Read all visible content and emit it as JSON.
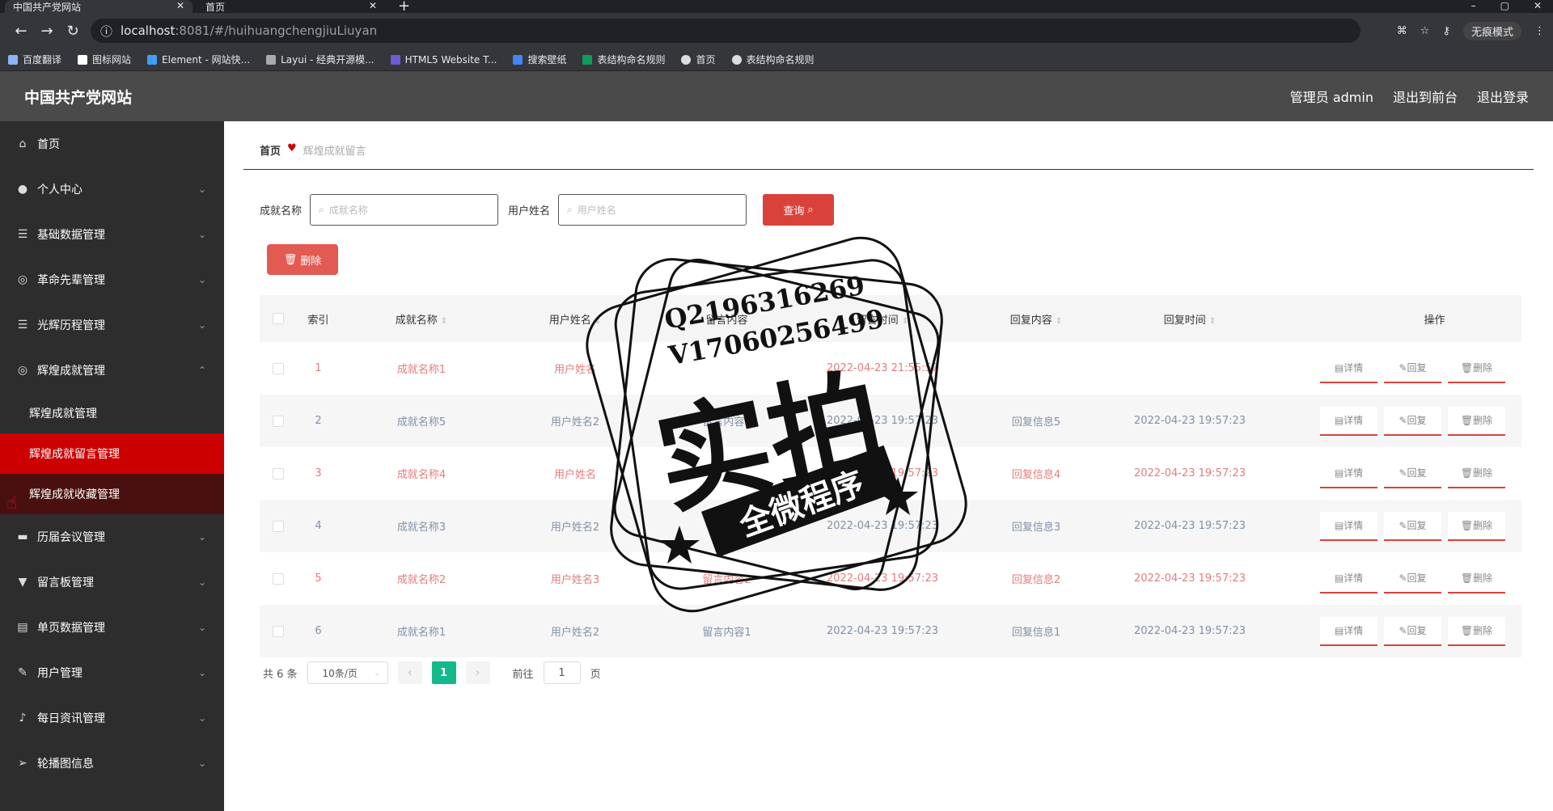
{
  "browser": {
    "tabs": [
      {
        "label": "中国共产党网站",
        "active": true
      },
      {
        "label": "首页",
        "active": false
      }
    ],
    "url_host": "localhost",
    "url_path": ":8081/#/huihuangchengjiuLiuyan",
    "incognito_label": "无痕模式",
    "bookmarks": [
      "百度翻译",
      "图标网站",
      "Element - 网站快...",
      "Layui - 经典开源模...",
      "HTML5 Website T...",
      "搜索壁纸",
      "表结构命名规则",
      "首页",
      "表结构命名规则"
    ]
  },
  "header": {
    "title": "中国共产党网站",
    "admin": "管理员 admin",
    "to_front": "退出到前台",
    "logout": "退出登录"
  },
  "sidebar": {
    "items": [
      {
        "label": "首页",
        "icon": "home-icon"
      },
      {
        "label": "个人中心",
        "icon": "user-icon"
      },
      {
        "label": "基础数据管理",
        "icon": "list-icon"
      },
      {
        "label": "革命先辈管理",
        "icon": "compass-icon"
      },
      {
        "label": "光辉历程管理",
        "icon": "list-icon"
      },
      {
        "label": "辉煌成就管理",
        "icon": "compass-icon"
      }
    ],
    "sub_items": [
      "辉煌成就管理",
      "辉煌成就留言管理",
      "辉煌成就收藏管理"
    ],
    "items_after": [
      {
        "label": "历届会议管理",
        "icon": "briefcase-icon"
      },
      {
        "label": "留言板管理",
        "icon": "board-icon"
      },
      {
        "label": "单页数据管理",
        "icon": "doc-icon"
      },
      {
        "label": "用户管理",
        "icon": "pen-icon"
      },
      {
        "label": "每日资讯管理",
        "icon": "mic-icon"
      },
      {
        "label": "轮播图信息",
        "icon": "send-icon"
      }
    ]
  },
  "breadcrumb": {
    "home": "首页",
    "current": "辉煌成就留言"
  },
  "search": {
    "name_label": "成就名称",
    "name_placeholder": "成就名称",
    "user_label": "用户姓名",
    "user_placeholder": "用户姓名",
    "query_label": "查询",
    "delete_label": "删除"
  },
  "table": {
    "headers": {
      "idx": "索引",
      "name": "成就名称",
      "user": "用户姓名",
      "msg": "留言内容",
      "time": "留言时间",
      "reply": "回复内容",
      "rtime": "回复时间",
      "op": "操作"
    },
    "rows": [
      {
        "idx": "1",
        "name": "成就名称1",
        "user": "用户姓名",
        "msg": "",
        "time": "2022-04-23 21:55:57",
        "reply": "",
        "rtime": "",
        "style": "pink"
      },
      {
        "idx": "2",
        "name": "成就名称5",
        "user": "用户姓名2",
        "msg": "留言内容5",
        "time": "2022-04-23 19:57:23",
        "reply": "回复信息5",
        "rtime": "2022-04-23 19:57:23",
        "style": "blue"
      },
      {
        "idx": "3",
        "name": "成就名称4",
        "user": "用户姓名",
        "msg": "",
        "time": "2022-04-23 19:57:23",
        "reply": "回复信息4",
        "rtime": "2022-04-23 19:57:23",
        "style": "pink"
      },
      {
        "idx": "4",
        "name": "成就名称3",
        "user": "用户姓名2",
        "msg": "",
        "time": "2022-04-23 19:57:23",
        "reply": "回复信息3",
        "rtime": "2022-04-23 19:57:23",
        "style": "blue"
      },
      {
        "idx": "5",
        "name": "成就名称2",
        "user": "用户姓名3",
        "msg": "留言内容2",
        "time": "2022-04-23 19:57:23",
        "reply": "回复信息2",
        "rtime": "2022-04-23 19:57:23",
        "style": "pink"
      },
      {
        "idx": "6",
        "name": "成就名称1",
        "user": "用户姓名2",
        "msg": "留言内容1",
        "time": "2022-04-23 19:57:23",
        "reply": "回复信息1",
        "rtime": "2022-04-23 19:57:23",
        "style": "blue"
      }
    ],
    "op_detail": "详情",
    "op_reply": "回复",
    "op_delete": "删除"
  },
  "pager": {
    "total": "共 6 条",
    "size": "10条/页",
    "current": "1",
    "goto_label": "前往",
    "goto_value": "1",
    "page_unit": "页"
  },
  "stamp": {
    "line1": "Q2196316269",
    "line2": "V17060256499",
    "big": "实拍",
    "band": "全微程序"
  },
  "colors": {
    "accent_red": "#d9423b",
    "sidebar_active": "#cc0000",
    "pager_green": "#13b98b"
  }
}
